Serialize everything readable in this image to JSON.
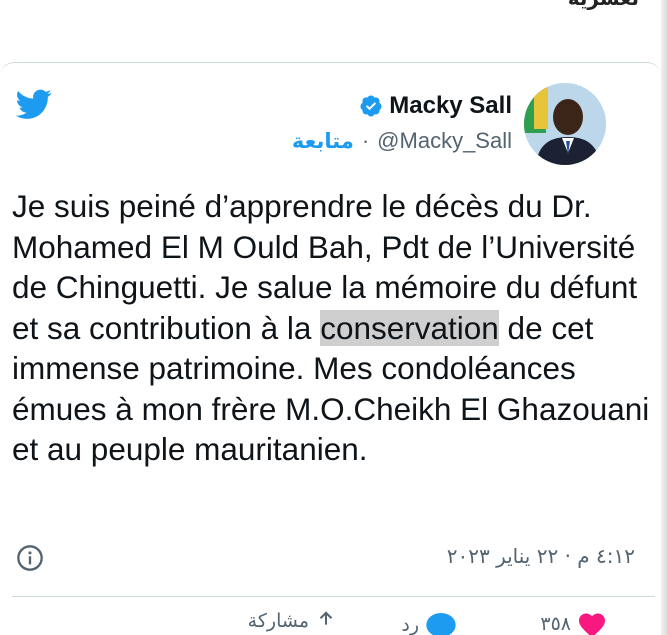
{
  "page": {
    "top_fragment": "لعشرية"
  },
  "tweet": {
    "author_name": "Macky Sall",
    "handle": "@Macky_Sall",
    "separator": "·",
    "follow_label": "متابعة",
    "text_parts": {
      "before": "Je suis peiné d’apprendre le décès du Dr. Mohamed El M Ould Bah, Pdt de l’Université de Chinguetti. Je salue la mémoire du défunt et sa contribution à la ",
      "highlight": "conservation",
      "after": " de cet immense patrimoine. Mes condoléances émues à mon frère M.O.Cheikh El Ghazouani et au peuple mauritanien."
    },
    "timestamp": "٤:١٢ م · ٢٢ يناير ٢٠٢٣",
    "likes_count": "٣٥٨",
    "reply_label": "رد",
    "share_label": "مشاركة"
  },
  "colors": {
    "brand": "#1d9bf0",
    "like": "#f91880",
    "text": "#0f1419",
    "muted": "#536471"
  },
  "icons": [
    "twitter-bird-icon",
    "verified-badge-icon",
    "info-icon",
    "heart-icon",
    "reply-bubble-icon",
    "share-icon"
  ]
}
